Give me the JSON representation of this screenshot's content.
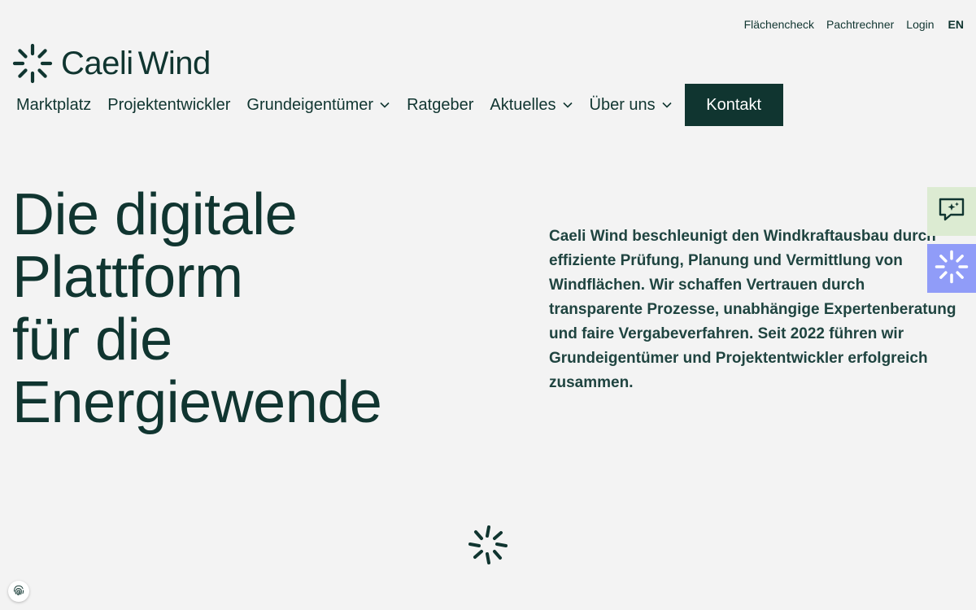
{
  "utility_nav": {
    "items": [
      "Flächencheck",
      "Pachtrechner",
      "Login"
    ],
    "language": "EN"
  },
  "logo": {
    "word1": "Caeli",
    "word2": "Wind",
    "icon": "sunburst-logo-icon"
  },
  "main_nav": {
    "items": [
      {
        "label": "Marktplatz",
        "dropdown": false
      },
      {
        "label": "Projektentwickler",
        "dropdown": false
      },
      {
        "label": "Grundeigentümer",
        "dropdown": true
      },
      {
        "label": "Ratgeber",
        "dropdown": false
      },
      {
        "label": "Aktuelles",
        "dropdown": true
      },
      {
        "label": "Über uns",
        "dropdown": true
      }
    ],
    "cta": "Kontakt"
  },
  "hero": {
    "title_lines": [
      "Die digitale",
      "Plattform",
      "für die",
      "Energiewende"
    ],
    "description": "Caeli Wind beschleunigt den Windkraftausbau durch effiziente Prüfung, Planung und Vermittlung von Windflächen. Wir schaffen Vertrauen durch transparente Prozesse, unabhängige Expertenberatung und faire Vergabeverfahren. Seit 2022 führen wir Grundeigentümer und Projektentwickler erfolgreich zusammen."
  },
  "side_buttons": {
    "chat_icon": "chat-sparkle-icon",
    "spark_icon": "sunburst-icon"
  },
  "loader_icon": "loading-spinner-icon",
  "cookie_icon": "fingerprint-icon",
  "colors": {
    "primary": "#103530",
    "background": "#f3f3f3",
    "chat_bg": "#dcebd2",
    "spark_bg": "#909cf8"
  }
}
